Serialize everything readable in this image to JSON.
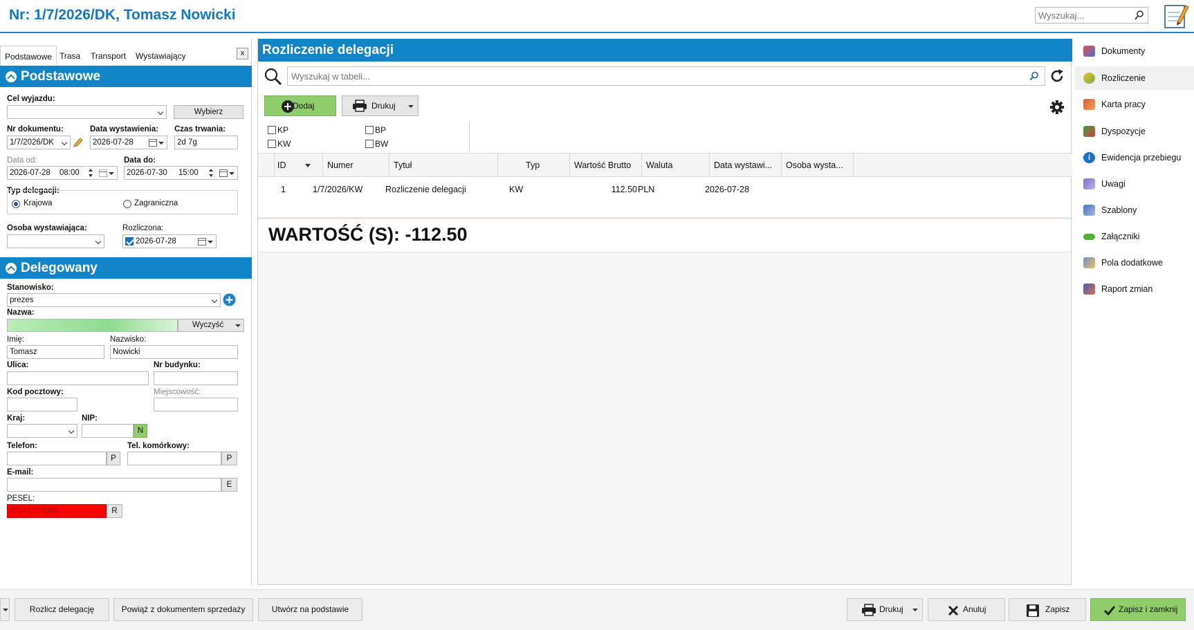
{
  "header": {
    "title": "Nr: 1/7/2026/DK, Tomasz Nowicki",
    "search_placeholder": "Wyszukaj..."
  },
  "left": {
    "tabs": [
      "Podstawowe",
      "Trasa",
      "Transport",
      "Wystawiający"
    ],
    "close_label": "x",
    "sec1": {
      "title": "Podstawowe",
      "cel_label": "Cel wyjazdu:",
      "cel_value": "",
      "wybierz": "Wybierz",
      "nr_label": "Nr dokumentu:",
      "nr_value": "1/7/2026/DK",
      "data_wyst_label": "Data wystawienia:",
      "data_wyst_value": "2026-07-28",
      "czas_label": "Czas trwania:",
      "czas_value": "2d 7g",
      "data_od_label": "Data od:",
      "data_od_date": "2026-07-28",
      "data_od_time": "08:00",
      "data_do_label": "Data do:",
      "data_do_date": "2026-07-30",
      "data_do_time": "15:00",
      "typ_label": "Typ delegacji:",
      "typ_krajowa": "Krajowa",
      "typ_zagraniczna": "Zagraniczna",
      "osoba_label": "Osoba wystawiająca:",
      "osoba_value": "",
      "rozliczona_label": "Rozliczona:",
      "rozliczona_value": "2026-07-28"
    },
    "sec2": {
      "title": "Delegowany",
      "stanowisko_label": "Stanowisko:",
      "stanowisko_value": "prezes",
      "nazwa_label": "Nazwa:",
      "wyczysc": "Wyczyść",
      "imie_label": "Imię:",
      "imie_value": "Tomasz",
      "nazwisko_label": "Nazwisko:",
      "nazwisko_value": "Nowicki",
      "ulica_label": "Ulica:",
      "nr_budynku_label": "Nr budynku:",
      "kod_label": "Kod pocztowy:",
      "miejscowosc_label": "Miejscowość:",
      "kraj_label": "Kraj:",
      "nip_label": "NIP:",
      "nip_btn": "N",
      "telefon_label": "Telefon:",
      "tel_btn": "P",
      "telkom_label": "Tel. komórkowy:",
      "telkom_btn": "P",
      "email_label": "E-mail:",
      "email_btn": "E",
      "pesel_label": "PESEL:",
      "pesel_value": "86041723569",
      "pesel_btn": "R"
    }
  },
  "main": {
    "title": "Rozliczenie delegacji",
    "search_placeholder": "Wyszukaj w tabeli...",
    "add_label": "Dodaj",
    "print_label": "Drukuj",
    "filters": [
      "KP",
      "KW",
      "BP",
      "BW"
    ],
    "columns": [
      "ID",
      "Numer",
      "Tytuł",
      "Typ",
      "Wartość Brutto",
      "Waluta",
      "Data wystawi...",
      "Osoba wysta..."
    ],
    "rows": [
      {
        "id": "1",
        "numer": "1/7/2026/KW",
        "tytul": "Rozliczenie delegacji",
        "typ": "KW",
        "wartosc": "112.50",
        "waluta": "PLN",
        "data": "2026-07-28",
        "osoba": ""
      }
    ],
    "total": "WARTOŚĆ (S): -112.50"
  },
  "right": {
    "items": [
      "Dokumenty",
      "Rozliczenie",
      "Karta pracy",
      "Dyspozycje",
      "Ewidencja przebiegu",
      "Uwagi",
      "Szablony",
      "Załączniki",
      "Pola dodatkowe",
      "Raport zmian"
    ]
  },
  "footer": {
    "rozlicz": "Rozlicz delegację",
    "powiaz": "Powiąż z dokumentem sprzedaży",
    "utworz": "Utwórz na podstawie",
    "drukuj": "Drukuj",
    "anuluj": "Anuluj",
    "zapisz": "Zapisz",
    "zapisz_zamknij": "Zapisz i zamknij"
  },
  "colors": {
    "accent": "#1185c8",
    "green_btn": "#8fcc6a",
    "pesel_bg": "#ff0000",
    "name_bar": "#9ee29e"
  }
}
